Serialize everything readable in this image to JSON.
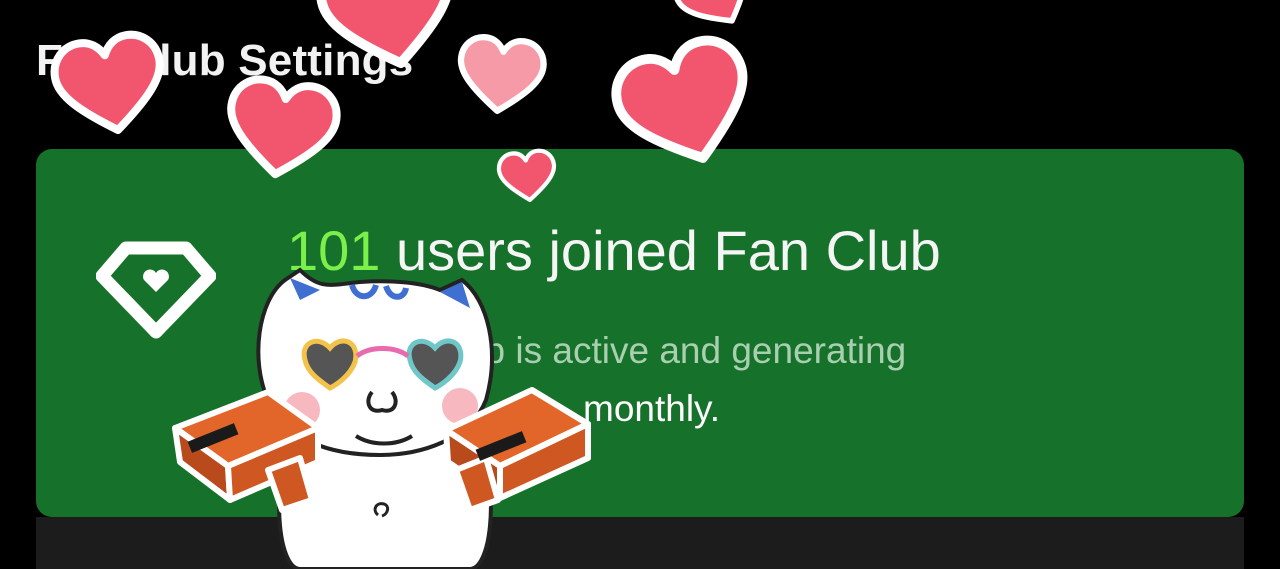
{
  "header": {
    "title": "Fan Club Settings"
  },
  "status_card": {
    "member_count": "101",
    "headline_suffix": " users joined Fan Club",
    "description_start": "Fan Club is active and generating",
    "description_end": "monthly."
  },
  "colors": {
    "background": "#000000",
    "card_green": "#16722a",
    "count_highlight": "#7cf04a",
    "heart_pink": "#f2566e",
    "footer_bar": "#1c1c1c"
  },
  "icons": {
    "card_icon": "diamond-heart-badge-icon"
  }
}
